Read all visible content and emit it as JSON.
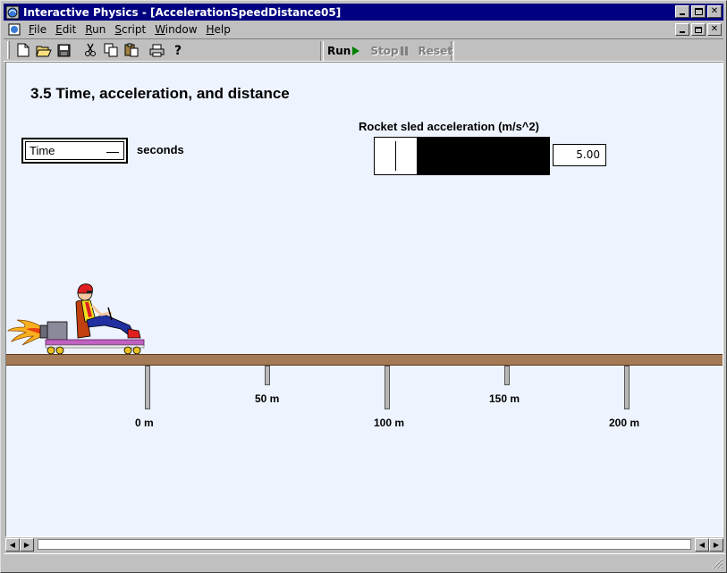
{
  "window": {
    "title": "Interactive Physics - [AccelerationSpeedDistance05]"
  },
  "menu": {
    "items": [
      {
        "key": "F",
        "rest": "ile"
      },
      {
        "key": "E",
        "rest": "dit"
      },
      {
        "key": "R",
        "rest": "un"
      },
      {
        "key": "S",
        "rest": "cript"
      },
      {
        "key": "W",
        "rest": "indow"
      },
      {
        "key": "H",
        "rest": "elp"
      }
    ]
  },
  "toolbar": {
    "icons": [
      "new-file-icon",
      "open-folder-icon",
      "save-icon",
      "cut-icon",
      "copy-icon",
      "paste-icon",
      "print-icon",
      "help-icon"
    ],
    "run_label": "Run",
    "stop_label": "Stop",
    "reset_label": "Reset"
  },
  "simulation": {
    "title": "3.5 Time, acceleration, and distance",
    "time_meter_label": "Time",
    "time_units": "seconds",
    "slider_label": "Rocket sled acceleration (m/s^2)",
    "slider_value": "5.00",
    "slider_fraction": 0.24,
    "distance_markers": [
      "0 m",
      "50 m",
      "100 m",
      "150 m",
      "200 m"
    ]
  },
  "colors": {
    "titlebar": "#000080",
    "workspace": "#eef4ff",
    "ground": "#a47a56"
  }
}
